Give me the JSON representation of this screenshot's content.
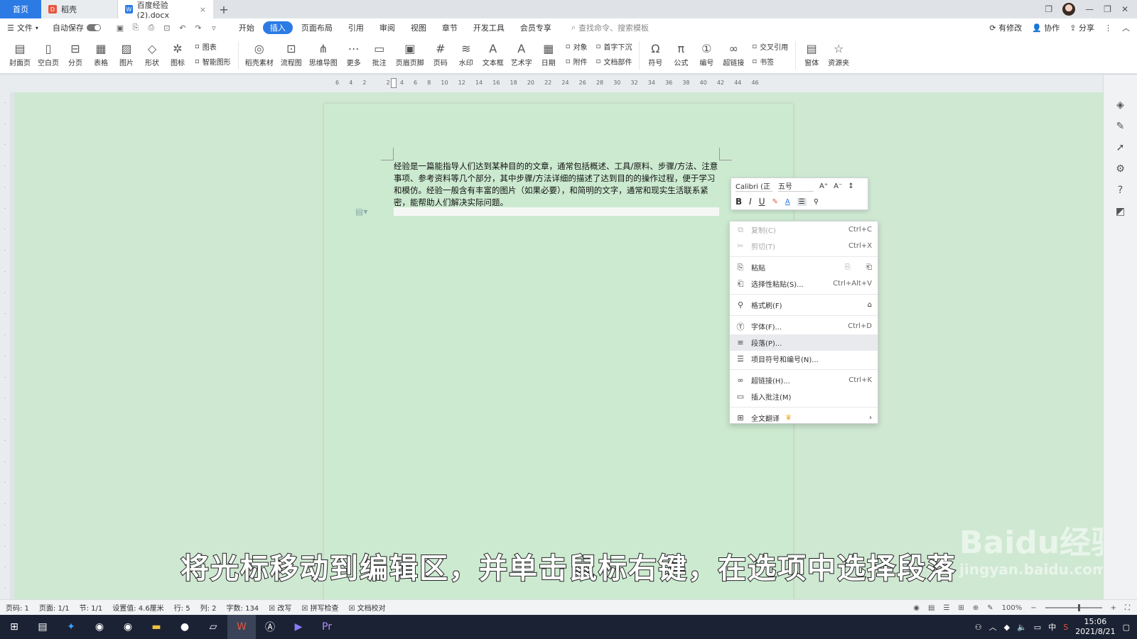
{
  "titlebar": {
    "tabs": [
      {
        "label": "首页"
      },
      {
        "label": "稻壳"
      },
      {
        "label": "百度经验 (2).docx"
      }
    ],
    "add_tab": "+"
  },
  "menubar": {
    "file": "文件",
    "autosave": "自动保存",
    "tabs": [
      "开始",
      "插入",
      "页面布局",
      "引用",
      "审阅",
      "视图",
      "章节",
      "开发工具",
      "会员专享"
    ],
    "active_tab": "插入",
    "search_placeholder": "查找命令、搜索模板",
    "right": {
      "modified": "有修改",
      "collab": "协作",
      "share": "分享"
    }
  },
  "ribbon": {
    "buttons": [
      {
        "label": "封面页",
        "icon": "cover-page-icon",
        "glyph": "▤"
      },
      {
        "label": "空白页",
        "icon": "blank-page-icon",
        "glyph": "▯"
      },
      {
        "label": "分页",
        "icon": "page-break-icon",
        "glyph": "⊟"
      },
      {
        "label": "表格",
        "icon": "table-icon",
        "glyph": "▦"
      },
      {
        "label": "图片",
        "icon": "picture-icon",
        "glyph": "▨"
      },
      {
        "label": "形状",
        "icon": "shape-icon",
        "glyph": "◇"
      },
      {
        "label": "图标",
        "icon": "icons-icon",
        "glyph": "✲"
      }
    ],
    "stack1": {
      "top": "图表",
      "bottom": "智能图形"
    },
    "buttons2": [
      {
        "label": "稻壳素材",
        "icon": "material-icon",
        "glyph": "◎"
      },
      {
        "label": "流程图",
        "icon": "flowchart-icon",
        "glyph": "⊡"
      },
      {
        "label": "思维导图",
        "icon": "mindmap-icon",
        "glyph": "⋔"
      },
      {
        "label": "更多",
        "icon": "more-icon",
        "glyph": "⋯"
      },
      {
        "label": "批注",
        "icon": "comment-icon",
        "glyph": "▭"
      },
      {
        "label": "页眉页脚",
        "icon": "header-footer-icon",
        "glyph": "▣"
      },
      {
        "label": "页码",
        "icon": "page-number-icon",
        "glyph": "#"
      },
      {
        "label": "水印",
        "icon": "watermark-icon",
        "glyph": "≋"
      },
      {
        "label": "文本框",
        "icon": "textbox-icon",
        "glyph": "A"
      },
      {
        "label": "艺术字",
        "icon": "wordart-icon",
        "glyph": "A"
      },
      {
        "label": "日期",
        "icon": "date-icon",
        "glyph": "▦"
      }
    ],
    "stack2": {
      "top": "对象",
      "bottom": "附件"
    },
    "stack3": {
      "top": "首字下沉",
      "bottom": "文档部件"
    },
    "buttons3": [
      {
        "label": "符号",
        "icon": "symbol-icon",
        "glyph": "Ω"
      },
      {
        "label": "公式",
        "icon": "formula-icon",
        "glyph": "π"
      },
      {
        "label": "编号",
        "icon": "numbering-icon",
        "glyph": "①"
      },
      {
        "label": "超链接",
        "icon": "hyperlink-icon",
        "glyph": "∞"
      }
    ],
    "stack4": {
      "top": "交叉引用",
      "bottom": "书签"
    },
    "buttons4": [
      {
        "label": "窗体",
        "icon": "form-icon",
        "glyph": "▤"
      },
      {
        "label": "资源夹",
        "icon": "resource-folder-icon",
        "glyph": "☆"
      }
    ]
  },
  "ruler": {
    "ticks": [
      "6",
      "4",
      "2",
      "",
      "2",
      "4",
      "6",
      "8",
      "10",
      "12",
      "14",
      "16",
      "18",
      "20",
      "22",
      "24",
      "26",
      "28",
      "30",
      "32",
      "34",
      "36",
      "38",
      "40",
      "42",
      "44",
      "46"
    ]
  },
  "document": {
    "paragraph": "经验是一篇能指导人们达到某种目的的文章，通常包括概述、工具/原料、步骤/方法、注意事项、参考资料等几个部分，其中步骤/方法详细的描述了达到目的的操作过程，便于学习和模仿。经验一般含有丰富的图片（如果必要），和简明的文字，通常和现实生活联系紧密，能帮助人们解决实际问题。"
  },
  "mini_toolbar": {
    "font": "Calibri (正",
    "size": "五号"
  },
  "context_menu": {
    "items": [
      {
        "label": "复制(C)",
        "shortcut": "Ctrl+C",
        "icon": "copy-icon",
        "glyph": "⧉",
        "disabled": true
      },
      {
        "label": "剪切(T)",
        "shortcut": "Ctrl+X",
        "icon": "cut-icon",
        "glyph": "✂",
        "disabled": true
      },
      {
        "label": "粘贴",
        "shortcut": "",
        "icon": "paste-icon",
        "glyph": "⎘",
        "disabled": false
      },
      {
        "label": "选择性粘贴(S)...",
        "shortcut": "Ctrl+Alt+V",
        "icon": "paste-special-icon",
        "glyph": "⎗",
        "disabled": false
      },
      {
        "label": "格式刷(F)",
        "shortcut": "",
        "icon": "format-painter-icon",
        "glyph": "⚲",
        "disabled": false
      },
      {
        "label": "字体(F)...",
        "shortcut": "Ctrl+D",
        "icon": "font-icon",
        "glyph": "Ⓣ",
        "disabled": false
      },
      {
        "label": "段落(P)...",
        "shortcut": "",
        "icon": "paragraph-icon",
        "glyph": "≡",
        "disabled": false,
        "hover": true
      },
      {
        "label": "项目符号和编号(N)...",
        "shortcut": "",
        "icon": "bullets-icon",
        "glyph": "☰",
        "disabled": false
      },
      {
        "label": "超链接(H)...",
        "shortcut": "Ctrl+K",
        "icon": "hyperlink-icon",
        "glyph": "∞",
        "disabled": false
      },
      {
        "label": "插入批注(M)",
        "shortcut": "",
        "icon": "insert-comment-icon",
        "glyph": "▭",
        "disabled": false
      },
      {
        "label": "全文翻译",
        "shortcut": "",
        "icon": "translate-icon",
        "glyph": "⊞",
        "disabled": false
      }
    ]
  },
  "subtitle": "将光标移动到编辑区，并单击鼠标右键，在选项中选择段落",
  "watermark": {
    "brand": "Baidu经验",
    "url": "jingyan.baidu.com"
  },
  "statusbar": {
    "page_num": "页码: 1",
    "pages": "页面: 1/1",
    "section": "节: 1/1",
    "position": "设置值: 4.6厘米",
    "row": "行: 5",
    "col": "列: 2",
    "word_count": "字数: 134",
    "overwrite": "改写",
    "spellcheck": "拼写检查",
    "proofread": "文档校对",
    "zoom": "100%"
  },
  "taskbar": {
    "time": "15:06",
    "date": "2021/8/21",
    "ime": "中"
  },
  "colors": {
    "accent": "#2c7be5",
    "canvas": "#cfe8d2",
    "taskbar": "#1b2233"
  }
}
